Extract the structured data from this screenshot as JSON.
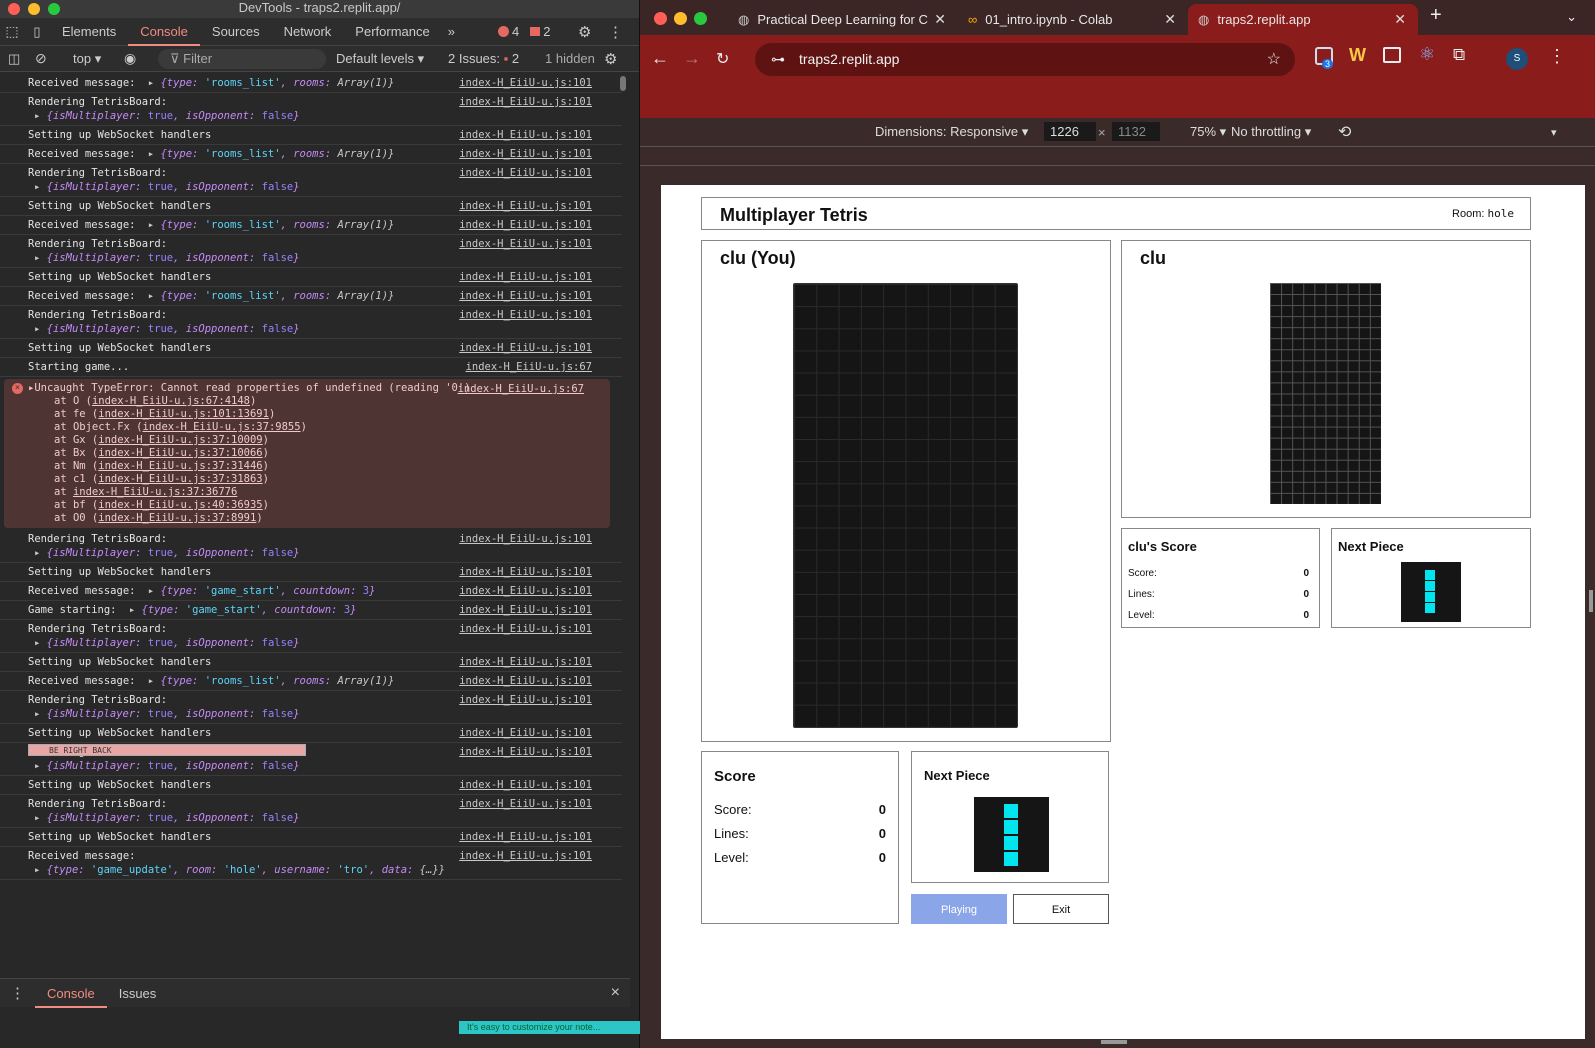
{
  "devtools": {
    "window_title": "DevTools - traps2.replit.app/",
    "tabs": [
      "Elements",
      "Console",
      "Sources",
      "Network",
      "Performance"
    ],
    "error_count": "4",
    "message_count": "2",
    "context": "top",
    "filter_placeholder": "Filter",
    "levels": "Default levels",
    "issues": "2 Issues:",
    "issues_count": "2",
    "hidden": "1 hidden",
    "bottom_tabs": [
      "Console",
      "Issues"
    ]
  },
  "logs": [
    {
      "text": "Received message:",
      "obj": "rooms",
      "src": "index-H_EiiU-u.js:101"
    },
    {
      "text": "Rendering TetrisBoard:",
      "obj": "board",
      "src": "index-H_EiiU-u.js:101"
    },
    {
      "text": "Setting up WebSocket handlers",
      "src": "index-H_EiiU-u.js:101"
    },
    {
      "text": "Received message:",
      "obj": "rooms",
      "src": "index-H_EiiU-u.js:101"
    },
    {
      "text": "Rendering TetrisBoard:",
      "obj": "board",
      "src": "index-H_EiiU-u.js:101"
    },
    {
      "text": "Setting up WebSocket handlers",
      "src": "index-H_EiiU-u.js:101"
    },
    {
      "text": "Received message:",
      "obj": "rooms",
      "src": "index-H_EiiU-u.js:101"
    },
    {
      "text": "Rendering TetrisBoard:",
      "obj": "board",
      "src": "index-H_EiiU-u.js:101"
    },
    {
      "text": "Setting up WebSocket handlers",
      "src": "index-H_EiiU-u.js:101"
    },
    {
      "text": "Received message:",
      "obj": "rooms",
      "src": "index-H_EiiU-u.js:101"
    },
    {
      "text": "Rendering TetrisBoard:",
      "obj": "board",
      "src": "index-H_EiiU-u.js:101"
    },
    {
      "text": "Setting up WebSocket handlers",
      "src": "index-H_EiiU-u.js:101"
    },
    {
      "text": "Starting game...",
      "src": "index-H_EiiU-u.js:67"
    }
  ],
  "error": {
    "message": "Uncaught TypeError: Cannot read properties of undefined (reading '0')",
    "src": "index-H_EiiU-u.js:67",
    "stack": [
      [
        "at O (",
        "index-H_EiiU-u.js:67:4148",
        ")"
      ],
      [
        "at fe (",
        "index-H_EiiU-u.js:101:13691",
        ")"
      ],
      [
        "at Object.Fx (",
        "index-H_EiiU-u.js:37:9855",
        ")"
      ],
      [
        "at Gx (",
        "index-H_EiiU-u.js:37:10009",
        ")"
      ],
      [
        "at Bx (",
        "index-H_EiiU-u.js:37:10066",
        ")"
      ],
      [
        "at Nm (",
        "index-H_EiiU-u.js:37:31446",
        ")"
      ],
      [
        "at c1 (",
        "index-H_EiiU-u.js:37:31863",
        ")"
      ],
      [
        "at ",
        "index-H_EiiU-u.js:37:36776",
        ""
      ],
      [
        "at bf (",
        "index-H_EiiU-u.js:40:36935",
        ")"
      ],
      [
        "at O0 (",
        "index-H_EiiU-u.js:37:8991",
        ")"
      ]
    ]
  },
  "logs2": [
    {
      "text": "Rendering TetrisBoard:",
      "obj": "board",
      "src": "index-H_EiiU-u.js:101"
    },
    {
      "text": "Setting up WebSocket handlers",
      "src": "index-H_EiiU-u.js:101"
    },
    {
      "text": "Received message:",
      "obj": "gamestart",
      "src": "index-H_EiiU-u.js:101"
    },
    {
      "text": "Game starting:",
      "obj": "gamestart",
      "src": "index-H_EiiU-u.js:101"
    },
    {
      "text": "Rendering TetrisBoard:",
      "obj": "board",
      "src": "index-H_EiiU-u.js:101"
    },
    {
      "text": "Setting up WebSocket handlers",
      "src": "index-H_EiiU-u.js:101"
    },
    {
      "text": "Received message:",
      "obj": "rooms",
      "src": "index-H_EiiU-u.js:101"
    },
    {
      "text": "Rendering TetrisBoard:",
      "obj": "board",
      "src": "index-H_EiiU-u.js:101"
    },
    {
      "text": "Setting up WebSocket handlers",
      "src": "index-H_EiiU-u.js:101"
    },
    {
      "text": "Rendering TetrisBoard:",
      "obj": "board",
      "src": "index-H_EiiU-u.js:101",
      "overlay": "BE RIGHT BACK"
    },
    {
      "text": "Setting up WebSocket handlers",
      "src": "index-H_EiiU-u.js:101"
    },
    {
      "text": "Rendering TetrisBoard:",
      "obj": "board",
      "src": "index-H_EiiU-u.js:101"
    },
    {
      "text": "Setting up WebSocket handlers",
      "src": "index-H_EiiU-u.js:101"
    },
    {
      "text": "Received message:",
      "obj": "update",
      "src": "index-H_EiiU-u.js:101"
    }
  ],
  "objs": {
    "rooms": [
      [
        "k",
        "{type: "
      ],
      [
        "s",
        "'rooms_list'"
      ],
      [
        "k",
        ", rooms: "
      ],
      [
        "n",
        "Array(1)}"
      ]
    ],
    "board": [
      [
        "k",
        "{isMultiplayer: "
      ],
      [
        "b",
        "true"
      ],
      [
        "k",
        ", isOpponent: "
      ],
      [
        "b",
        "false"
      ],
      [
        "k",
        "}"
      ]
    ],
    "gamestart": [
      [
        "k",
        "{type: "
      ],
      [
        "s",
        "'game_start'"
      ],
      [
        "k",
        ", countdown: "
      ],
      [
        "b",
        "3"
      ],
      [
        "k",
        "}"
      ]
    ],
    "update": [
      [
        "k",
        "{type: "
      ],
      [
        "s",
        "'game_update'"
      ],
      [
        "k",
        ", room: "
      ],
      [
        "s",
        "'hole'"
      ],
      [
        "k",
        ", username: "
      ],
      [
        "s",
        "'tro'"
      ],
      [
        "k",
        ", data: "
      ],
      [
        "n",
        "{…}}"
      ]
    ]
  },
  "browser": {
    "tabs": [
      "Practical Deep Learning for C",
      "01_intro.ipynb - Colab",
      "traps2.replit.app"
    ],
    "url": "traps2.replit.app",
    "profile": "S",
    "ext_badge": "3",
    "dimensions": "Dimensions: Responsive",
    "width": "1226",
    "height": "1132",
    "zoom": "75%",
    "throttle": "No throttling"
  },
  "game": {
    "title": "Multiplayer Tetris",
    "room_label": "Room:",
    "room_code": "hole",
    "player_label": "clu (You)",
    "opponent_label": "clu",
    "score_title": "Score",
    "opp_score_title": "clu's Score",
    "next_title": "Next Piece",
    "labels": [
      "Score:",
      "Lines:",
      "Level:"
    ],
    "values": [
      "0",
      "0",
      "0"
    ],
    "opp_values": [
      "0",
      "0",
      "0"
    ],
    "playing_btn": "Playing",
    "exit_btn": "Exit"
  },
  "notice": "It's easy to customize your note..."
}
